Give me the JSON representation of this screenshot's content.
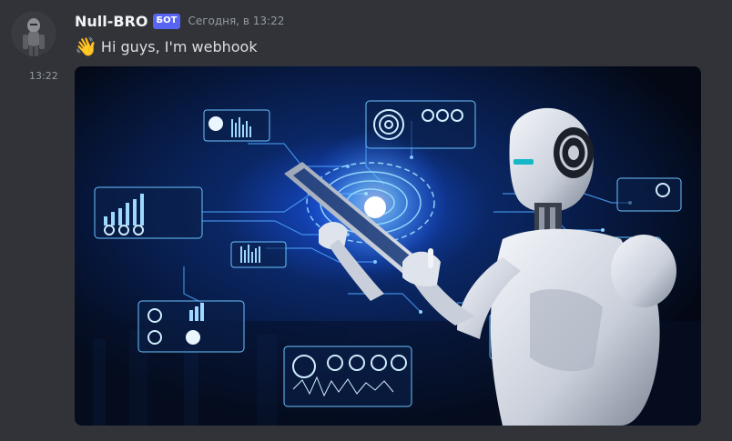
{
  "message": {
    "username": "Null-BRO",
    "badge": "БОТ",
    "timestamp": "Сегодня, в 13:22",
    "side_time": "13:22",
    "emoji": "👋",
    "text": "Hi guys, I'm webhook"
  },
  "colors": {
    "background": "#313338",
    "badge": "#5865f2",
    "username": "#f2f3f5",
    "muted": "#949ba4"
  }
}
